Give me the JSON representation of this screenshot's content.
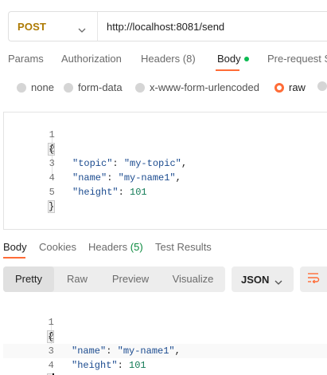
{
  "request": {
    "method": "POST",
    "url": "http://localhost:8081/send"
  },
  "request_tabs": [
    {
      "label": "Params"
    },
    {
      "label": "Authorization"
    },
    {
      "label": "Headers",
      "count": "(8)"
    },
    {
      "label": "Body"
    },
    {
      "label": "Pre-request Sc"
    }
  ],
  "body_types": [
    "none",
    "form-data",
    "x-www-form-urlencoded",
    "raw",
    ""
  ],
  "request_body": {
    "line_numbers": [
      "1",
      "2",
      "3",
      "4",
      "5"
    ],
    "open_brace": "{",
    "close_brace": "}",
    "pairs": [
      {
        "key": "\"topic\"",
        "value": "\"my-topic\"",
        "sep": ": ",
        "tail": ","
      },
      {
        "key": "\"name\"",
        "value": "\"my-name1\"",
        "sep": ": ",
        "tail": ","
      },
      {
        "key": "\"height\"",
        "value": "101",
        "sep": ": ",
        "tail": ""
      }
    ]
  },
  "response_tabs": [
    {
      "label": "Body"
    },
    {
      "label": "Cookies"
    },
    {
      "label": "Headers",
      "count": "(5)"
    },
    {
      "label": "Test Results"
    }
  ],
  "response_views": [
    "Pretty",
    "Raw",
    "Preview",
    "Visualize"
  ],
  "response_format": "JSON",
  "response_body": {
    "line_numbers": [
      "1",
      "2",
      "3",
      "4"
    ],
    "open_brace": "{",
    "close_brace": "}",
    "pairs": [
      {
        "key": "\"name\"",
        "value": "\"my-name1\"",
        "sep": ": ",
        "tail": ","
      },
      {
        "key": "\"height\"",
        "value": "101",
        "sep": ": ",
        "tail": ""
      }
    ]
  },
  "colors": {
    "accent": "#ff6c37",
    "method_post": "#ad7a03",
    "status_dot": "#0cbb52",
    "count_green": "#0b8a3e"
  },
  "icons": {
    "method_dropdown": "chevron-down-icon",
    "format_dropdown": "chevron-down-icon",
    "wrap": "wrap-lines-icon"
  }
}
